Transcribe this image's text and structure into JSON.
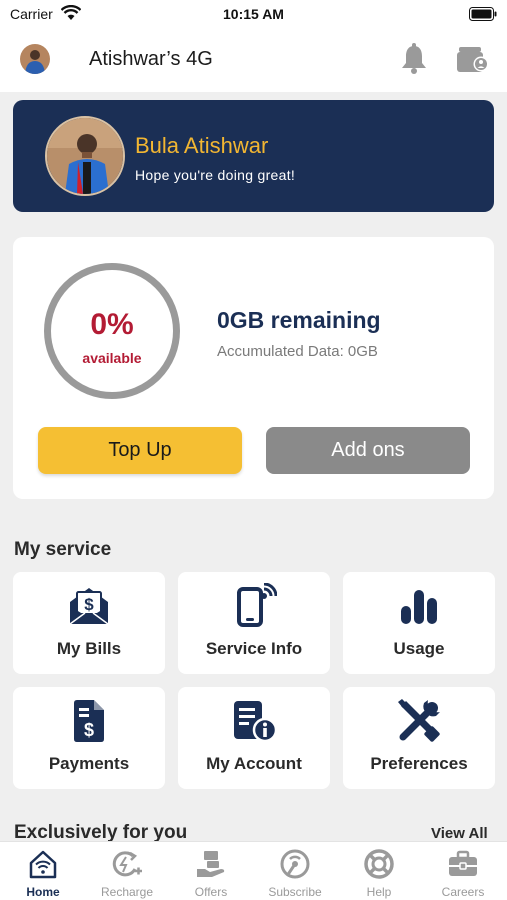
{
  "status_bar": {
    "carrier": "Carrier",
    "time": "10:15 AM"
  },
  "header": {
    "title": "Atishwar’s 4G"
  },
  "welcome": {
    "name": "Bula Atishwar",
    "subtitle": "Hope you're doing great!"
  },
  "data_usage": {
    "percent_label": "0%",
    "percent_value": 0,
    "available_label": "available",
    "remaining": "0GB remaining",
    "accumulated": "Accumulated Data: 0GB"
  },
  "actions": {
    "top_up": "Top Up",
    "add_ons": "Add ons"
  },
  "my_service": {
    "title": "My service",
    "tiles": [
      {
        "label": "My Bills",
        "icon": "bill-envelope-icon"
      },
      {
        "label": "Service Info",
        "icon": "phone-signal-icon"
      },
      {
        "label": "Usage",
        "icon": "bar-chart-icon"
      },
      {
        "label": "Payments",
        "icon": "payment-document-icon"
      },
      {
        "label": "My Account",
        "icon": "account-info-icon"
      },
      {
        "label": "Preferences",
        "icon": "tools-icon"
      }
    ]
  },
  "exclusive": {
    "title": "Exclusively for you",
    "view_all": "View All"
  },
  "bottom_nav": {
    "items": [
      {
        "label": "Home",
        "icon": "home-wifi-icon",
        "active": true
      },
      {
        "label": "Recharge",
        "icon": "recharge-icon",
        "active": false
      },
      {
        "label": "Offers",
        "icon": "offers-hand-icon",
        "active": false
      },
      {
        "label": "Subscribe",
        "icon": "subscribe-signal-icon",
        "active": false
      },
      {
        "label": "Help",
        "icon": "lifebuoy-icon",
        "active": false
      },
      {
        "label": "Careers",
        "icon": "briefcase-icon",
        "active": false
      }
    ]
  },
  "colors": {
    "brand_navy": "#1b2f55",
    "accent_yellow": "#f5bf33",
    "name_gold": "#f2b632",
    "alert_red": "#b31b34",
    "secondary_grey": "#8a8a8a"
  }
}
